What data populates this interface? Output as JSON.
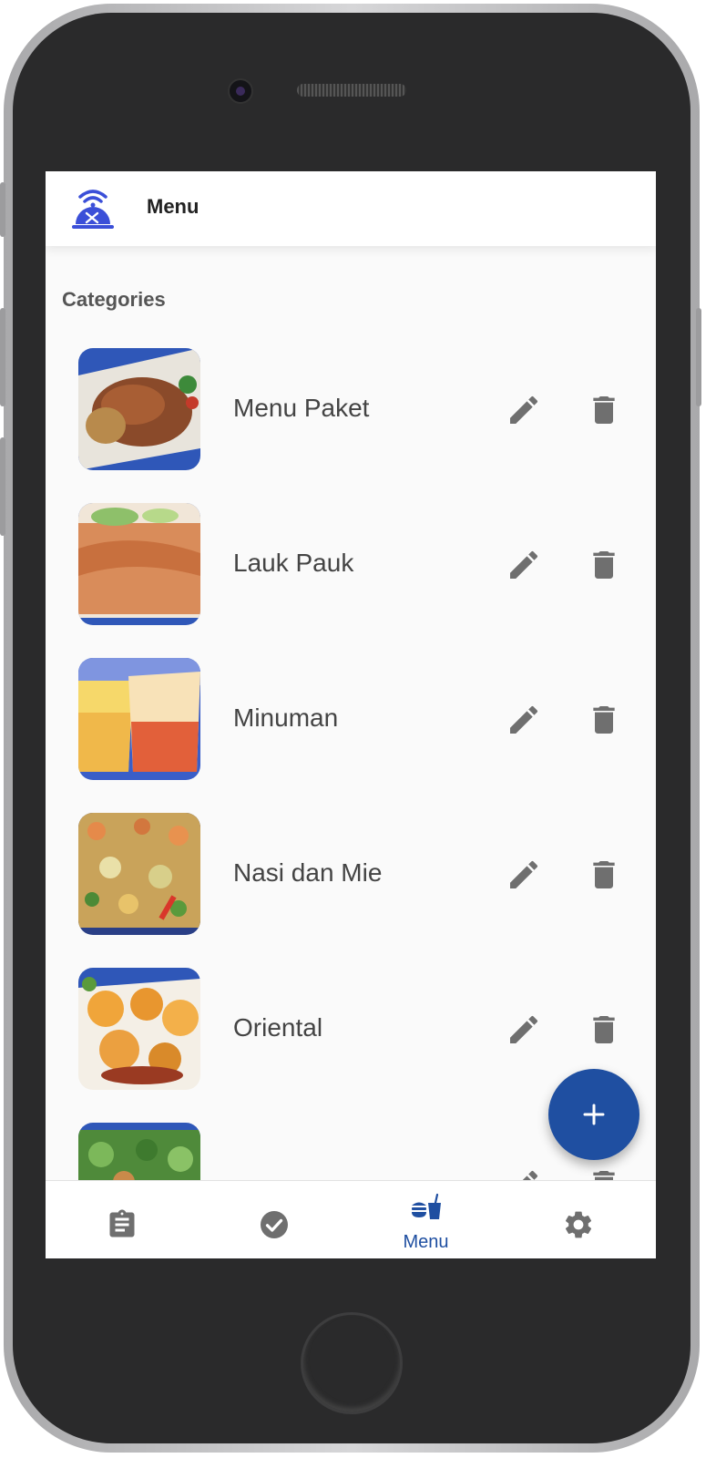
{
  "app_bar": {
    "title": "Menu",
    "logo_icon": "restaurant-wifi-logo-icon"
  },
  "section": {
    "title": "Categories"
  },
  "categories": [
    {
      "name": "Menu Paket",
      "image": "grilled-chicken-photo"
    },
    {
      "name": "Lauk Pauk",
      "image": "fried-fish-photo"
    },
    {
      "name": "Minuman",
      "image": "drinks-photo"
    },
    {
      "name": "Nasi dan Mie",
      "image": "fried-rice-photo"
    },
    {
      "name": "Oriental",
      "image": "fried-shrimp-photo"
    },
    {
      "name": "",
      "image": "vegetables-photo"
    }
  ],
  "actions": {
    "edit_icon": "pencil-icon",
    "delete_icon": "trash-icon"
  },
  "fab": {
    "icon": "plus-icon"
  },
  "bottom_nav": {
    "items": [
      {
        "icon": "clipboard-icon",
        "label": ""
      },
      {
        "icon": "check-circle-icon",
        "label": ""
      },
      {
        "icon": "fastfood-icon",
        "label": "Menu",
        "active": true
      },
      {
        "icon": "gear-icon",
        "label": ""
      }
    ]
  },
  "colors": {
    "primary": "#1f4fa1",
    "icon_gray": "#6f6f6f",
    "text": "#444444",
    "background": "#fafafa"
  }
}
